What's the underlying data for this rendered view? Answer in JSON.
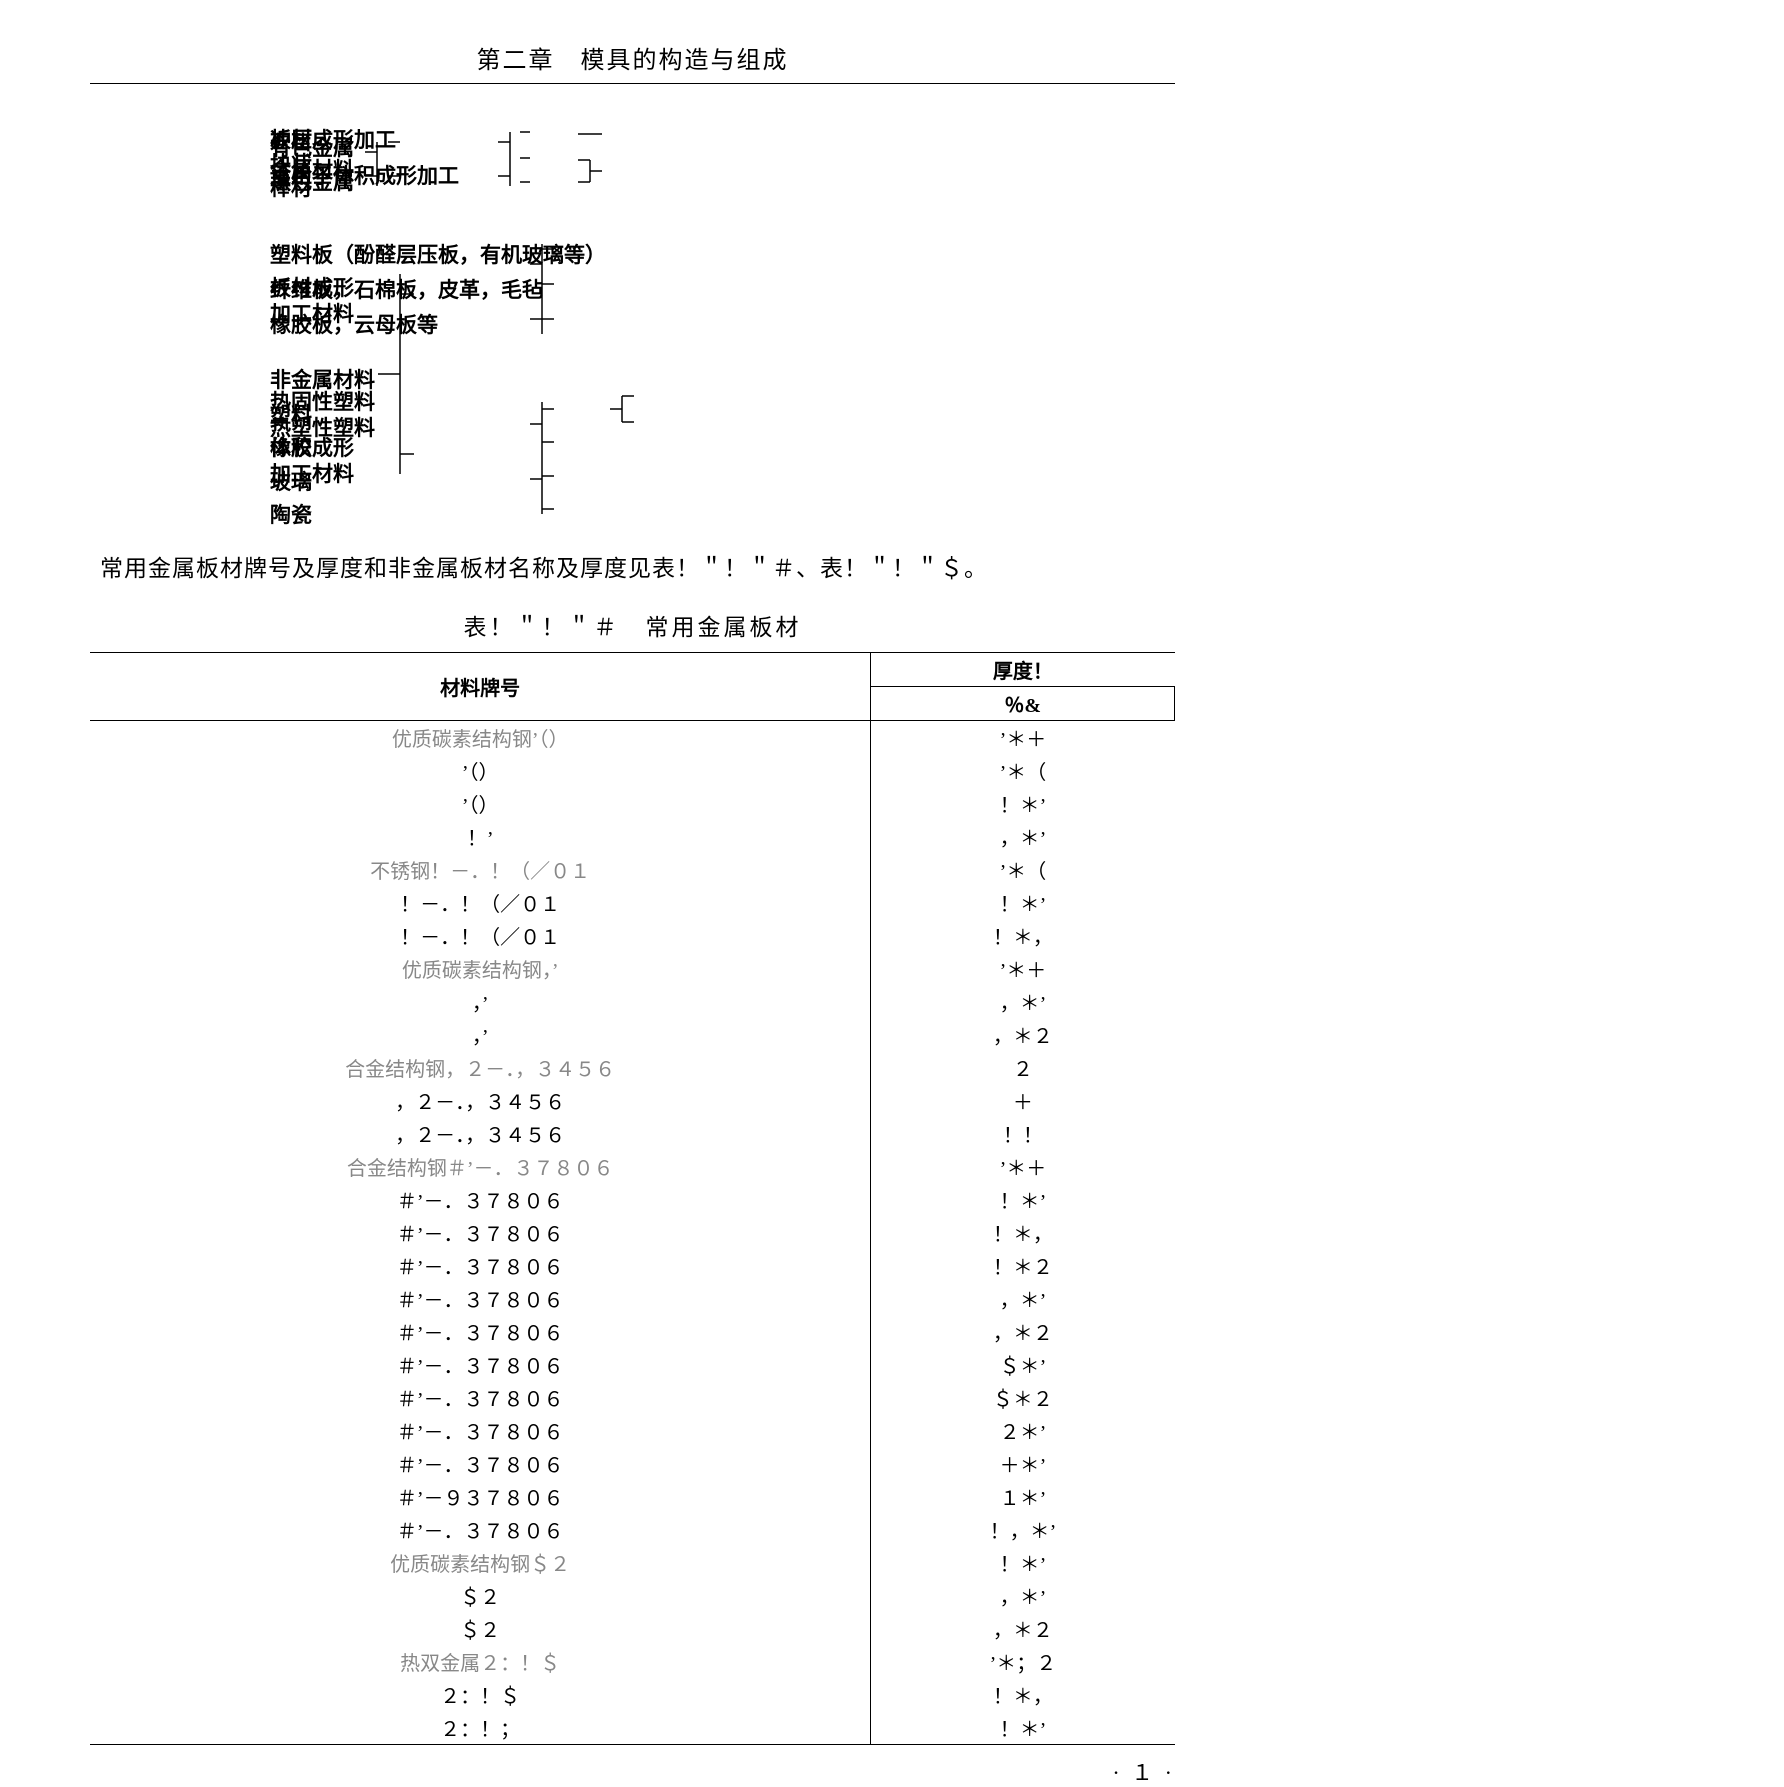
{
  "header": "第二章　模具的构造与组成",
  "diagram": {
    "n1": "金属材料",
    "n2": "有色金属",
    "n3": "黑色金属",
    "n4": "板材",
    "n5": "块状",
    "n6": "棒材",
    "n7": "冲压成形加工",
    "n8": "适用于体积成形加工",
    "n9": "非金属材料",
    "n10a": "板材成形",
    "n10b": "加工材料",
    "n11": "塑料板（酚醛层压板，有机玻璃等）",
    "n12": "纤维板，石棉板，皮革，毛毡",
    "n13": "橡胶板，云母板等",
    "n14a": "体积成形",
    "n14b": "加工材料",
    "n15": "塑料",
    "n16": "橡胶",
    "n17": "玻璃",
    "n18": "陶瓷",
    "n19": "热固性塑料",
    "n20": "热塑性塑料"
  },
  "intro": "常用金属板材牌号及厚度和非金属板材名称及厚度见表！＂！＂＃、表！＂！＂＄。",
  "table_caption": "表！＂！＂＃　常用金属板材",
  "th_material": "材料牌号",
  "th_thickness1": "厚度！",
  "th_thickness2": "％&",
  "rows": [
    {
      "c1": "优质碳素结构钢’（）",
      "c2": "’＊＋",
      "gray1": true
    },
    {
      "c1": "’（）",
      "c2": "’＊（"
    },
    {
      "c1": "’（）",
      "c2": "！＊’"
    },
    {
      "c1": "！’",
      "c2": "，＊’"
    },
    {
      "c1": "不锈钢！－．！（／０１",
      "c2": "’＊（",
      "gray1": true
    },
    {
      "c1": "！－．！（／０１",
      "c2": "！＊’"
    },
    {
      "c1": "！－．！（／０１",
      "c2": "！＊，"
    },
    {
      "c1": "优质碳素结构钢，’",
      "c2": "’＊＋",
      "gray1": true
    },
    {
      "c1": "，’",
      "c2": "，＊’"
    },
    {
      "c1": "，’",
      "c2": "，＊２"
    },
    {
      "c1": "合金结构钢，２－．，３４５６",
      "c2": "２",
      "gray1": true
    },
    {
      "c1": "，２－．，３４５６",
      "c2": "＋"
    },
    {
      "c1": "，２－．，３４５６",
      "c2": "！！"
    },
    {
      "c1": "合金结构钢＃’－．３７８０６",
      "c2": "’＊＋",
      "gray1": true
    },
    {
      "c1": "＃’－．３７８０６",
      "c2": "！＊’"
    },
    {
      "c1": "＃’－．３７８０６",
      "c2": "！＊，"
    },
    {
      "c1": "＃’－．３７８０６",
      "c2": "！＊２"
    },
    {
      "c1": "＃’－．３７８０６",
      "c2": "，＊’"
    },
    {
      "c1": "＃’－．３７８０６",
      "c2": "，＊２"
    },
    {
      "c1": "＃’－．３７８０６",
      "c2": "＄＊’"
    },
    {
      "c1": "＃’－．３７８０６",
      "c2": "＄＊２"
    },
    {
      "c1": "＃’－．３７８０６",
      "c2": "２＊’"
    },
    {
      "c1": "＃’－．３７８０６",
      "c2": "＋＊’"
    },
    {
      "c1": "＃’－９３７８０６",
      "c2": "１＊’"
    },
    {
      "c1": "＃’－．３７８０６",
      "c2": "！，＊’"
    },
    {
      "c1": "优质碳素结构钢＄２",
      "c2": "！＊’",
      "gray1": true
    },
    {
      "c1": "＄２",
      "c2": "，＊’"
    },
    {
      "c1": "＄２",
      "c2": "，＊２"
    },
    {
      "c1": "热双金属２：！＄",
      "c2": "’＊；２",
      "gray1": true
    },
    {
      "c1": "２：！＄",
      "c2": "！＊，"
    },
    {
      "c1": "２：！；",
      "c2": "！＊’"
    }
  ],
  "page_number": "· １ ·"
}
